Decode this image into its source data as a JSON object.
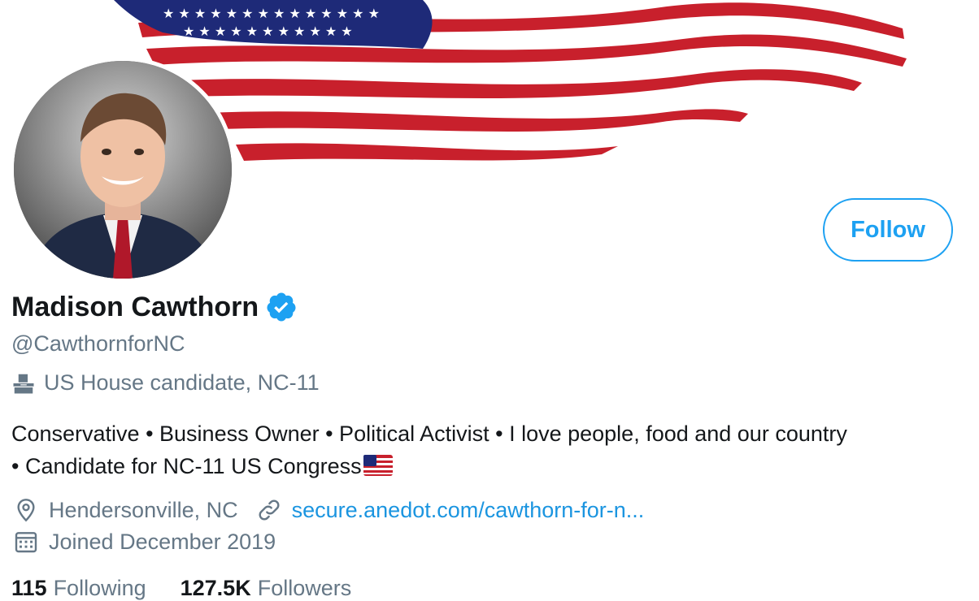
{
  "profile": {
    "name": "Madison Cawthorn",
    "handle": "@CawthornforNC",
    "category": "US House candidate, NC-11",
    "bio_line1": "Conservative • Business Owner • Political Activist • I love people, food and our country",
    "bio_line2": "• Candidate for NC-11 US Congress",
    "location": "Hendersonville, NC",
    "website": "secure.anedot.com/cawthorn-for-n...",
    "joined": "Joined December 2019",
    "following_count": "115",
    "following_label": "Following",
    "followers_count": "127.5K",
    "followers_label": "Followers"
  },
  "actions": {
    "follow_label": "Follow"
  },
  "icons": {
    "verified": "verified-badge-icon",
    "category": "ballot-box-icon",
    "location": "location-pin-icon",
    "link": "link-icon",
    "calendar": "calendar-icon",
    "flag": "us-flag-emoji"
  },
  "colors": {
    "accent": "#1da1f2",
    "link": "#1b95e0",
    "secondary_text": "#657786",
    "primary_text": "#14171a",
    "flag_red": "#c8202c",
    "flag_blue": "#1e2a78"
  }
}
